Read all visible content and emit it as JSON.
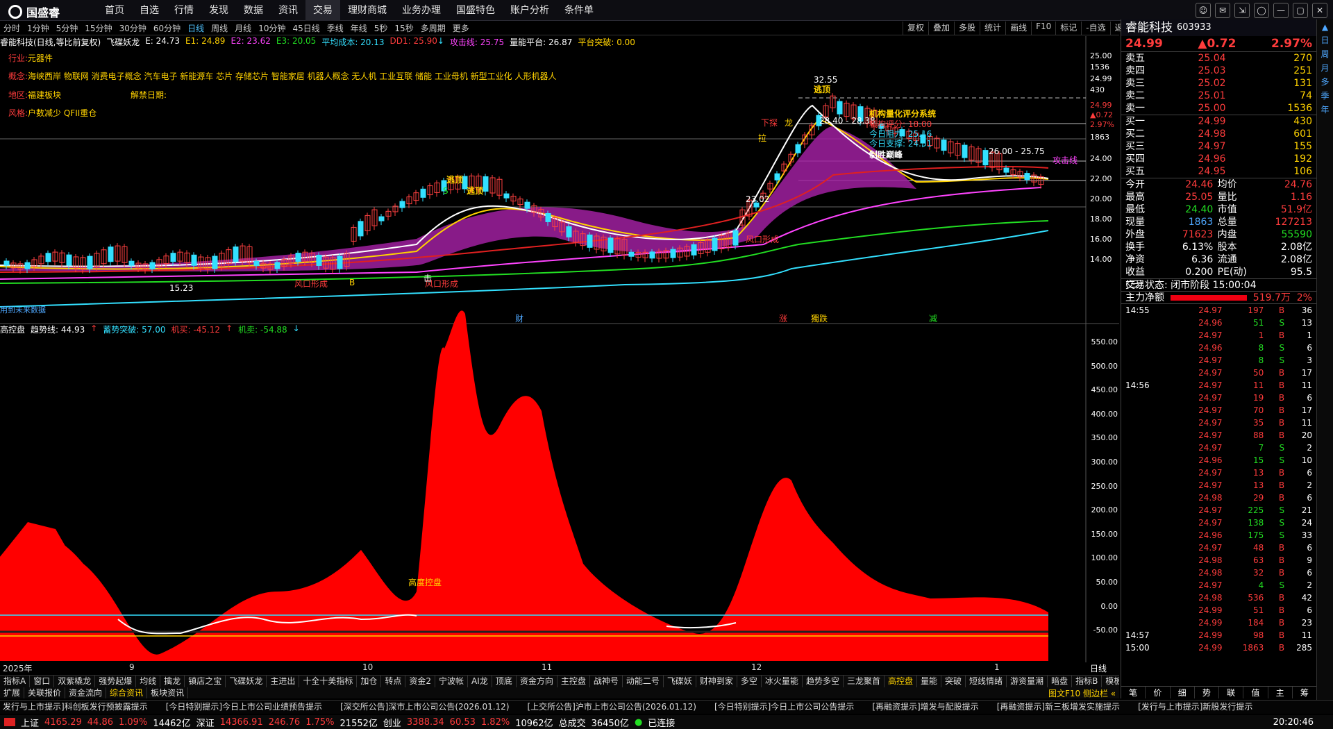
{
  "app": {
    "logo": "国盛睿",
    "nav": [
      "首页",
      "自选",
      "行情",
      "发现",
      "数据",
      "资讯",
      "交易",
      "理财商城",
      "业务办理",
      "国盛特色",
      "账户分析",
      "条件单"
    ],
    "active_nav": "交易"
  },
  "window_buttons": [
    "☺",
    "✉",
    "⇲",
    "◯",
    "—",
    "▢",
    "✕"
  ],
  "periods": [
    "分时",
    "1分钟",
    "5分钟",
    "15分钟",
    "30分钟",
    "60分钟",
    "日线",
    "周线",
    "月线",
    "10分钟",
    "45日线",
    "季线",
    "年线",
    "5秒",
    "15秒",
    "多周期",
    "更多"
  ],
  "active_period": "日线",
  "chart_tools": [
    "复权",
    "叠加",
    "多股",
    "统计",
    "画线",
    "F10",
    "标记",
    "-自选",
    "返回"
  ],
  "main_indicator": {
    "name": "睿能科技(日线,等比前复权)",
    "formula": "飞碟妖龙",
    "E": "E: 24.73",
    "E1": "E1: 24.89",
    "E2": "E2: 23.62",
    "E3": "E3: 20.05",
    "avg": "平均成本: 20.13",
    "dd": "DD1: 25.90",
    "dd_arrow": "↓",
    "attack": "攻击线: 25.75",
    "platform": "量能平台: 26.87",
    "breakout": "平台突破: 0.00"
  },
  "info": {
    "industry_label": "行业:",
    "industry": "元器件",
    "concept_label": "概念:",
    "concepts": "海峡西岸 物联网 消费电子概念 汽车电子 新能源车 芯片 存储芯片 智能家居 机器人概念 无人机 工业互联 储能 工业母机 新型工业化 人形机器人",
    "region_label": "地区:",
    "region": "福建板块",
    "unlock_label": "解禁日期:",
    "style_label": "风格:",
    "style": "户数减少 QFII重仓"
  },
  "annotations": {
    "high": "32.55",
    "escape_top": "逃顶",
    "range1": "28.40 - 28.38",
    "system": "机构量化评分系统",
    "score": "机构评分: 18.00",
    "resist": "今日阻力: 25.16",
    "support": "今日支撑: 24.51",
    "peak": "制胜巅峰",
    "range2": "26.00 - 25.75",
    "attack_line": "攻击线",
    "low1": "15.23",
    "low2": "23.02",
    "wind1": "风口形成",
    "wind2": "风口形成",
    "wind3": "风口形成",
    "escape1": "逃顶",
    "escape2": "逃顶",
    "lower_label": "下探",
    "dragon": "龙",
    "future": "用到未来数据",
    "events": [
      "财",
      "涨",
      "獨跌",
      "减"
    ],
    "rise": "拉",
    "buy": "B",
    "strike": "击",
    "label_s": "S"
  },
  "price_axis": [
    "25.00",
    "1536",
    "24.99",
    "430",
    "24.99",
    "▲0.72",
    "2.97%",
    "1863",
    "24.00",
    "22.00",
    "20.00",
    "18.00",
    "16.00",
    "14.00"
  ],
  "sub_indicator": {
    "name": "高控盘",
    "trend": "趋势线: 44.93",
    "trend_arrow": "↑",
    "breakout": "蓄势突破: 57.00",
    "inst_buy": "机买: -45.12",
    "inst_buy_arrow": "↑",
    "inst_sell": "机卖: -54.88",
    "inst_sell_arrow": "↓",
    "tag": "高度控盘"
  },
  "sub_axis": [
    "550.00",
    "500.00",
    "450.00",
    "400.00",
    "350.00",
    "300.00",
    "250.00",
    "200.00",
    "150.00",
    "100.00",
    "50.00",
    "0.00",
    "-50.00"
  ],
  "x_labels": [
    "2025年",
    "9",
    "10",
    "11",
    "12",
    "1"
  ],
  "x_period": "日线",
  "tabs1": [
    "指标A",
    "窗口",
    "双紫橇龙",
    "强势起爆",
    "均线",
    "擒龙",
    "镇店之宝",
    "飞碟妖龙",
    "主进出",
    "十全十美指标",
    "加仓",
    "转点",
    "资金2",
    "宁波帐",
    "AI龙",
    "顶底",
    "资金方向",
    "主控盘",
    "战神号",
    "动能二号",
    "飞碟妖",
    "财神到家",
    "多空",
    "冰火量能",
    "趋势多空",
    "三龙聚首",
    "高控盘",
    "量能",
    "突破",
    "短线情绪",
    "游资量潮",
    "暗盘",
    "指标B",
    "模板",
    "+",
    "−"
  ],
  "active_tab1": "高控盘",
  "tabs2": [
    "扩展",
    "关联报价",
    "资金流向",
    "综合资讯",
    "板块资讯"
  ],
  "active_tab2": "综合资讯",
  "tabs2_right": "图文F10 侧边栏 «",
  "ticker": [
    "发行与上市提示]科创板发行预披露提示",
    "[今日特别提示]今日上市公司业绩预告提示",
    "[深交所公告]深市上市公司公告(2026.01.12)",
    "[上交所公告]沪市上市公司公告(2026.01.12)",
    "[今日特别提示]今日上市公司公告提示",
    "[再融资提示]增发与配股提示",
    "[再融资提示]新三板增发实施提示",
    "[发行与上市提示]新股发行提示"
  ],
  "status": {
    "sh_label": "上证",
    "sh": "4165.29",
    "sh_chg": "44.86",
    "sh_pct": "1.09%",
    "sh_amt": "14462亿",
    "sz_label": "深证",
    "sz": "14366.91",
    "sz_chg": "246.76",
    "sz_pct": "1.75%",
    "sz_amt": "21552亿",
    "cy_label": "创业",
    "cy": "3388.34",
    "cy_chg": "60.53",
    "cy_pct": "1.82%",
    "cy_amt": "10962亿",
    "total_label": "总成交",
    "total": "36450亿",
    "conn": "已连接",
    "time": "20:20:46"
  },
  "stock": {
    "name": "睿能科技",
    "code": "603933",
    "price": "24.99",
    "chg": "▲0.72",
    "pct": "2.97%"
  },
  "orderbook": {
    "asks": [
      [
        "卖五",
        "25.04",
        "270"
      ],
      [
        "卖四",
        "25.03",
        "251"
      ],
      [
        "卖三",
        "25.02",
        "131"
      ],
      [
        "卖二",
        "25.01",
        "74"
      ],
      [
        "卖一",
        "25.00",
        "1536"
      ]
    ],
    "bids": [
      [
        "买一",
        "24.99",
        "430"
      ],
      [
        "买二",
        "24.98",
        "601"
      ],
      [
        "买三",
        "24.97",
        "155"
      ],
      [
        "买四",
        "24.96",
        "192"
      ],
      [
        "买五",
        "24.95",
        "106"
      ]
    ]
  },
  "stats": [
    [
      "今开",
      "24.46",
      "均价",
      "24.76"
    ],
    [
      "最高",
      "25.05",
      "量比",
      "1.16"
    ],
    [
      "最低",
      "24.40",
      "市值",
      "51.9亿"
    ],
    [
      "现量",
      "1863",
      "总量",
      "127213"
    ],
    [
      "外盘",
      "71623",
      "内盘",
      "55590"
    ],
    [
      "换手",
      "6.13%",
      "股本",
      "2.08亿"
    ],
    [
      "净资",
      "6.36",
      "流通",
      "2.08亿"
    ],
    [
      "收益(三)",
      "0.200",
      "PE(动)",
      "95.5"
    ]
  ],
  "trade_state": "交易状态: 闭市阶段 15:00:04",
  "main_flow": {
    "label": "主力净额",
    "value": "519.7万",
    "unit": "万",
    "pct": "2%"
  },
  "ticks": [
    [
      "14:55",
      "24.97",
      "197",
      "B",
      "36"
    ],
    [
      "",
      "24.96",
      "51",
      "S",
      "13"
    ],
    [
      "",
      "24.97",
      "1",
      "B",
      "1"
    ],
    [
      "",
      "24.96",
      "8",
      "S",
      "6"
    ],
    [
      "",
      "24.97",
      "8",
      "S",
      "3"
    ],
    [
      "",
      "24.97",
      "50",
      "B",
      "17"
    ],
    [
      "14:56",
      "24.97",
      "11",
      "B",
      "11"
    ],
    [
      "",
      "24.97",
      "19",
      "B",
      "6"
    ],
    [
      "",
      "24.97",
      "70",
      "B",
      "17"
    ],
    [
      "",
      "24.97",
      "35",
      "B",
      "11"
    ],
    [
      "",
      "24.97",
      "88",
      "B",
      "20"
    ],
    [
      "",
      "24.97",
      "7",
      "S",
      "2"
    ],
    [
      "",
      "24.96",
      "15",
      "S",
      "10"
    ],
    [
      "",
      "24.97",
      "13",
      "B",
      "6"
    ],
    [
      "",
      "24.97",
      "13",
      "B",
      "2"
    ],
    [
      "",
      "24.98",
      "29",
      "B",
      "6"
    ],
    [
      "",
      "24.97",
      "225",
      "S",
      "21"
    ],
    [
      "",
      "24.97",
      "138",
      "S",
      "24"
    ],
    [
      "",
      "24.96",
      "175",
      "S",
      "33"
    ],
    [
      "",
      "24.97",
      "48",
      "B",
      "6"
    ],
    [
      "",
      "24.98",
      "63",
      "B",
      "9"
    ],
    [
      "",
      "24.98",
      "32",
      "B",
      "6"
    ],
    [
      "",
      "24.97",
      "4",
      "S",
      "2"
    ],
    [
      "",
      "24.98",
      "536",
      "B",
      "42"
    ],
    [
      "",
      "24.99",
      "51",
      "B",
      "6"
    ],
    [
      "",
      "24.99",
      "184",
      "B",
      "23"
    ],
    [
      "14:57",
      "24.99",
      "98",
      "B",
      "11"
    ],
    [
      "15:00",
      "24.99",
      "1863",
      "B",
      "285"
    ]
  ],
  "rp_tabs": [
    "笔",
    "价",
    "细",
    "势",
    "联",
    "值",
    "主",
    "筹"
  ],
  "sidebar": [
    "▲",
    "日",
    "周",
    "月",
    "多",
    "季",
    "年"
  ]
}
